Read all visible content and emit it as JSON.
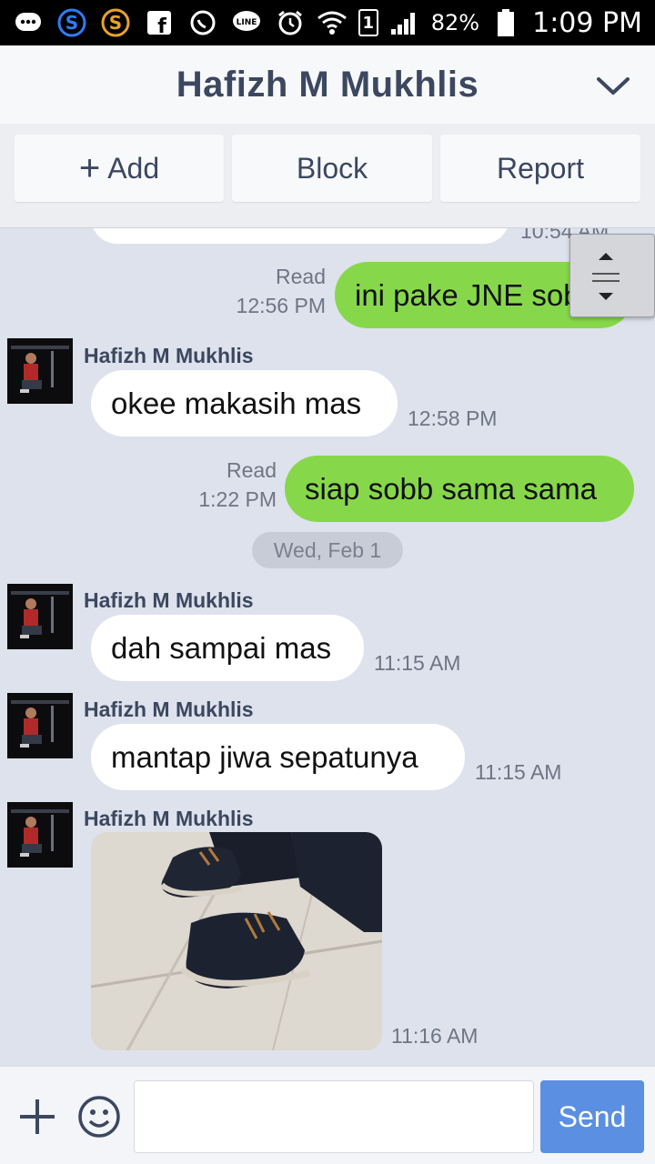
{
  "status_bar": {
    "battery_percent": "82%",
    "time": "1:09 PM",
    "sim_slot": "1",
    "icons": [
      "chat-bubble-icon",
      "skype-blue-icon",
      "skype-orange-icon",
      "facebook-icon",
      "whatsapp-icon",
      "line-icon",
      "alarm-icon",
      "wifi-icon",
      "sim-icon",
      "signal-icon",
      "battery-icon"
    ]
  },
  "header": {
    "title": "Hafizh M Mukhlis"
  },
  "actions": {
    "add_label": "Add",
    "block_label": "Block",
    "report_label": "Report"
  },
  "chat": {
    "partial_timestamp": "10:54 AM",
    "messages": [
      {
        "direction": "out",
        "text": "ini pake JNE sob",
        "read_label": "Read",
        "time": "12:56 PM"
      },
      {
        "direction": "in",
        "sender": "Hafizh M Mukhlis",
        "text": "okee makasih mas",
        "time": "12:58 PM"
      },
      {
        "direction": "out",
        "text": "siap sobb sama sama",
        "read_label": "Read",
        "time": "1:22 PM"
      },
      {
        "direction": "in",
        "sender": "Hafizh M Mukhlis",
        "text": "dah sampai mas",
        "time": "11:15 AM"
      },
      {
        "direction": "in",
        "sender": "Hafizh M Mukhlis",
        "text": "mantap jiwa sepatunya",
        "time": "11:15 AM"
      },
      {
        "direction": "in",
        "sender": "Hafizh M Mukhlis",
        "text": "",
        "time": "11:16 AM"
      }
    ],
    "date_divider": "Wed, Feb 1"
  },
  "input": {
    "value": "",
    "placeholder": "",
    "send_label": "Send"
  },
  "colors": {
    "outgoing_bubble": "#86d84a",
    "incoming_bubble": "#ffffff",
    "chat_background": "#dde2ec",
    "send_button": "#5b8fe2",
    "header_text": "#3c4760"
  }
}
